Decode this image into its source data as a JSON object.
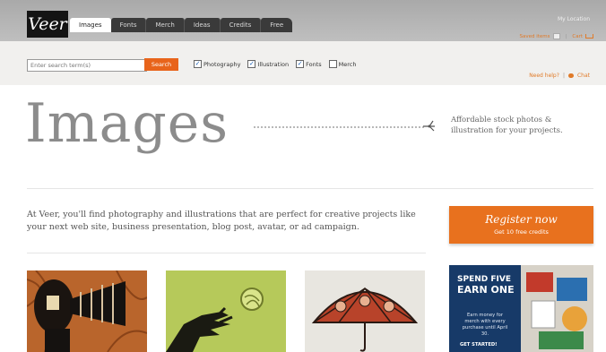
{
  "brand": {
    "logo_text": "Veer"
  },
  "nav": {
    "tabs": [
      {
        "label": "Images",
        "active": true
      },
      {
        "label": "Fonts"
      },
      {
        "label": "Merch"
      },
      {
        "label": "Ideas"
      },
      {
        "label": "Credits"
      },
      {
        "label": "Free"
      }
    ],
    "my_location": "My Location",
    "saved_items": "Saved items",
    "cart": "Cart"
  },
  "search": {
    "placeholder": "Enter search term(s)",
    "button_label": "Search",
    "filters": [
      {
        "label": "Photography",
        "checked": true
      },
      {
        "label": "Illustration",
        "checked": true
      },
      {
        "label": "Fonts",
        "checked": true
      },
      {
        "label": "Merch",
        "checked": false
      }
    ]
  },
  "help": {
    "need_help": "Need help?",
    "chat": "Chat"
  },
  "hero": {
    "title": "Images",
    "tagline": "Affordable stock photos & illustration for your projects."
  },
  "intro": "At Veer, you'll find photography and illustrations that are perfect for creative projects like your next web site, business presentation, blog post, avatar, or ad campaign.",
  "register": {
    "title": "Register now",
    "subtitle": "Get 10 free credits"
  },
  "promo": {
    "line1": "SPEND FIVE",
    "line2": "EARN ONE",
    "body": "Earn money for merch with every purchase until April 30.",
    "cta": "GET STARTED!"
  },
  "colors": {
    "accent": "#e8711e",
    "nav_dark": "#3a3a3a",
    "promo_bg": "#173a68"
  }
}
